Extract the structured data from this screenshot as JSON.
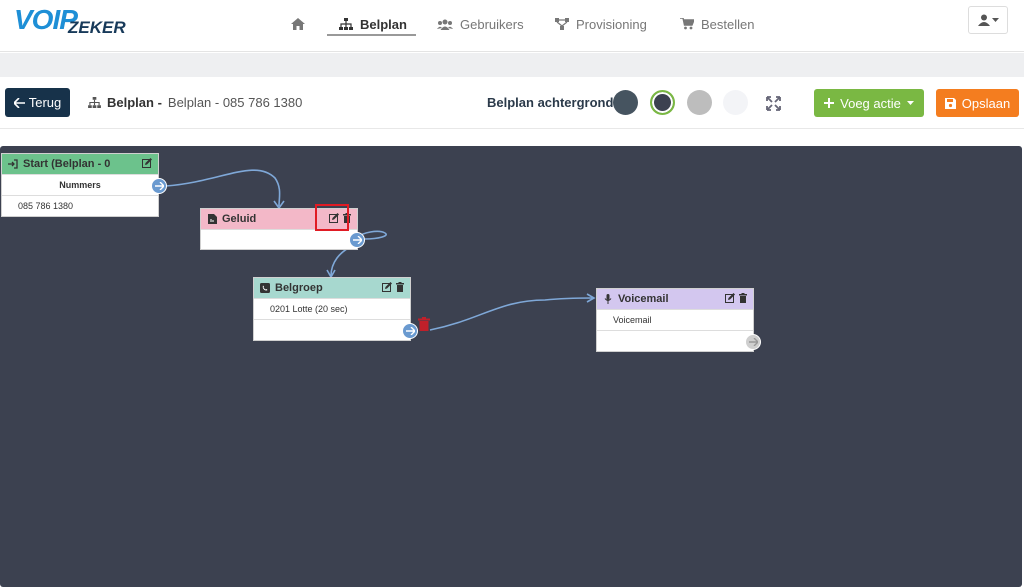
{
  "brand": {
    "part1": "VOIP",
    "part2": "ZEKER"
  },
  "nav": {
    "home_icon": "home-icon",
    "items": [
      {
        "label": "Belplan",
        "icon": "sitemap-icon",
        "active": true
      },
      {
        "label": "Gebruikers",
        "icon": "users-icon",
        "active": false
      },
      {
        "label": "Provisioning",
        "icon": "network-icon",
        "active": false
      },
      {
        "label": "Bestellen",
        "icon": "cart-icon",
        "active": false
      }
    ],
    "user_icon": "user-icon"
  },
  "toolbar": {
    "back_label": "Terug",
    "crumb_bold": "Belplan -",
    "crumb_rest": "Belplan - 085 786 1380",
    "background_label": "Belplan achtergrond",
    "swatches": [
      "#465460",
      "#3c4150",
      "#bdbdbd",
      "#f3f4f7"
    ],
    "selected_swatch_index": 1,
    "add_label": "Voeg actie",
    "save_label": "Opslaan"
  },
  "nodes": {
    "start": {
      "title": "Start (Belplan - 0",
      "subheader": "Nummers",
      "number": "085 786 1380",
      "color": "#6cc28c"
    },
    "geluid": {
      "title": "Geluid",
      "color": "#f3b8c8"
    },
    "belgroep": {
      "title": "Belgroep",
      "item": "0201 Lotte (20 sec)",
      "color": "#a7d8cf"
    },
    "voicemail": {
      "title": "Voicemail",
      "item": "Voicemail",
      "color": "#d3c7ef"
    }
  },
  "colors": {
    "canvas": "#3c4150",
    "wire": "#7fa8d8",
    "highlight": "#e01b24"
  }
}
